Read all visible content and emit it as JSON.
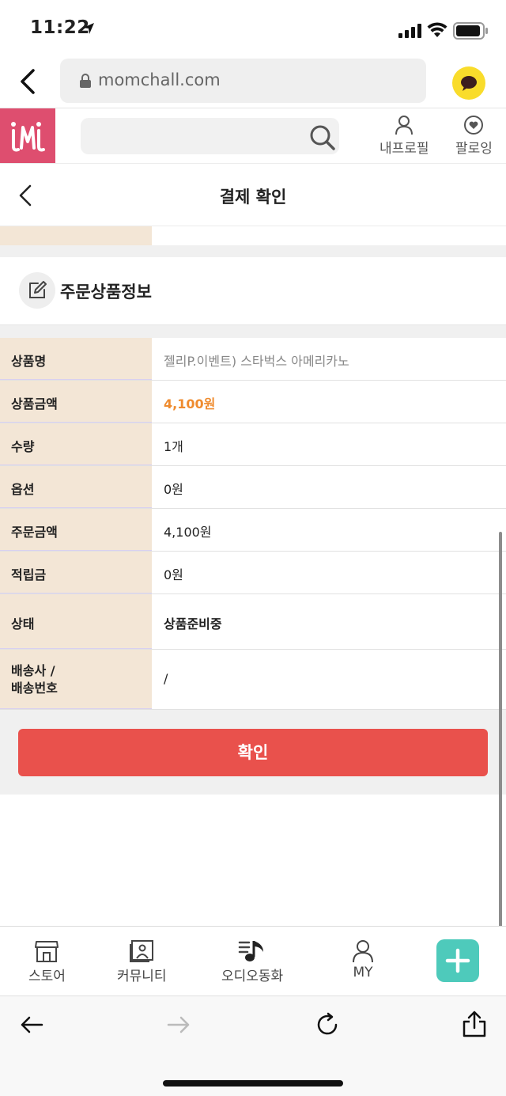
{
  "status_bar": {
    "time": "11:22"
  },
  "url_bar": {
    "url": "momchall.com"
  },
  "app_header": {
    "my_profile_label": "내프로필",
    "following_label": "팔로잉"
  },
  "page": {
    "title": "결제 확인",
    "section_title": "주문상품정보"
  },
  "order_info": [
    {
      "label": "상품명",
      "value": "젤리P.이벤트) 스타벅스 아메리카노"
    },
    {
      "label": "상품금액",
      "value": "4,100원"
    },
    {
      "label": "수량",
      "value": "1개"
    },
    {
      "label": "옵션",
      "value": "0원"
    },
    {
      "label": "주문금액",
      "value": "4,100원"
    },
    {
      "label": "적립금",
      "value": "0원"
    },
    {
      "label": "상태",
      "value": "상품준비중"
    },
    {
      "label": "배송사 /\n배송번호",
      "value": "/"
    }
  ],
  "colors": {
    "accent_price": "#ef8b2e",
    "confirm_button": "#e9514c",
    "label_bg": "#f3e6d6",
    "logo_bg": "#de4e6f",
    "plus_button": "#4ecabb"
  },
  "confirm_button_label": "확인",
  "bottom_nav": {
    "items": [
      "스토어",
      "커뮤니티",
      "오디오동화",
      "MY"
    ]
  }
}
